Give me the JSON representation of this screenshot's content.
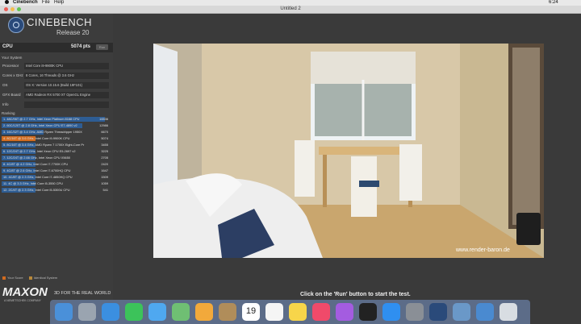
{
  "menubar": {
    "app": "Cinebench",
    "menus": [
      "File",
      "Help"
    ],
    "clock": "6:24"
  },
  "window": {
    "title": "Untitled 2"
  },
  "logo": {
    "title": "CINEBENCH",
    "release": "Release 20"
  },
  "cpu": {
    "label": "CPU",
    "score": "5074 pts",
    "run_label": "Run"
  },
  "system": {
    "heading": "Your System",
    "rows": [
      {
        "key": "Processor",
        "value": "Intel Core i9-9900K CPU"
      },
      {
        "key": "Cores x GHz",
        "value": "8 Cores, 16 Threads @ 3.6 GHz"
      },
      {
        "key": "OS",
        "value": "OS X: Version 10.15.6 (Build 19F101)"
      },
      {
        "key": "GFX Board",
        "value": "AMD Radeon RX 5700 XT OpenGL Engine"
      },
      {
        "key": "Info",
        "value": ""
      }
    ]
  },
  "ranking": {
    "heading": "Ranking",
    "rows": [
      {
        "name": "1. 48C/96T @ 2.7 GHz, Intel Xeon Platinum 8168 CPU",
        "score": "16536",
        "fill": 1.0,
        "mine": false
      },
      {
        "name": "2. 60C/120T @ 2.8 GHz, Intel Xeon CPU E7-4890 v2",
        "score": "12986",
        "fill": 0.785,
        "mine": false
      },
      {
        "name": "3. 16C/32T @ 3.4 GHz, AMD Ryzen Threadripper 1950X",
        "score": "6670",
        "fill": 0.403,
        "mine": false
      },
      {
        "name": "4. 8C/16T @ 3.6 GHz, Intel Core i9-9900K CPU",
        "score": "5074",
        "fill": 0.307,
        "mine": true
      },
      {
        "name": "5. 8C/16T @ 3.4 GHz, AMD Ryzen 7 1700X Eight-Core Pr",
        "score": "3455",
        "fill": 0.209,
        "mine": false
      },
      {
        "name": "6. 12C/24T @ 2.7 GHz, Intel Xeon CPU E5-2697 v2",
        "score": "3225",
        "fill": 0.195,
        "mine": false
      },
      {
        "name": "7. 12C/24T @ 2.66 GHz, Intel Xeon CPU X5650",
        "score": "2705",
        "fill": 0.164,
        "mine": false
      },
      {
        "name": "8. 4C/8T @ 4.2 GHz, Intel Core i7-7700K CPU",
        "score": "2420",
        "fill": 0.146,
        "mine": false
      },
      {
        "name": "9. 4C/8T @ 2.6 GHz, Intel Core i7-6700HQ CPU",
        "score": "1647",
        "fill": 0.1,
        "mine": false
      },
      {
        "name": "10. 4C/8T @ 2.3 GHz, Intel Core i7-4850HQ CPU",
        "score": "1509",
        "fill": 0.091,
        "mine": false
      },
      {
        "name": "11. 4C @ 3.3 GHz, Intel Core i5-3550 CPU",
        "score": "1059",
        "fill": 0.064,
        "mine": false
      },
      {
        "name": "12. 2C/4T @ 2.3 GHz, Intel Core i5-5300U CPU",
        "score": "541",
        "fill": 0.033,
        "mine": false
      }
    ]
  },
  "legend": {
    "your_score": "Your Score",
    "identical": "Identical System"
  },
  "brand": {
    "name": "MAXON",
    "sub": "A NEMETSCHEK COMPANY",
    "tagline": "3D FOR THE REAL WORLD"
  },
  "render": {
    "watermark": "www.render-baron.de"
  },
  "status": {
    "text": "Click on the 'Run' button to start the test."
  },
  "dock": {
    "icons": [
      {
        "name": "finder-icon",
        "color": "#4a90d9"
      },
      {
        "name": "launchpad-icon",
        "color": "#9aa4b0"
      },
      {
        "name": "safari-icon",
        "color": "#3b8fe0"
      },
      {
        "name": "facetime-icon",
        "color": "#3cc35a"
      },
      {
        "name": "messages-icon",
        "color": "#4fa8f0"
      },
      {
        "name": "maps-icon",
        "color": "#6fbf73"
      },
      {
        "name": "photos-icon",
        "color": "#f2a93b"
      },
      {
        "name": "contacts-icon",
        "color": "#b08d5a"
      },
      {
        "name": "calendar-icon",
        "color": "#ffffff"
      },
      {
        "name": "reminders-icon",
        "color": "#f5f5f5"
      },
      {
        "name": "notes-icon",
        "color": "#f7d54a"
      },
      {
        "name": "music-icon",
        "color": "#f04a6a"
      },
      {
        "name": "podcasts-icon",
        "color": "#a45ce0"
      },
      {
        "name": "tv-icon",
        "color": "#222222"
      },
      {
        "name": "app-store-icon",
        "color": "#2f8ff0"
      },
      {
        "name": "system-preferences-icon",
        "color": "#8a8f96"
      },
      {
        "name": "cinebench-icon",
        "color": "#2a4a7a"
      },
      {
        "name": "preview-icon",
        "color": "#6a98c8"
      },
      {
        "name": "downloads-icon",
        "color": "#4a8ad0"
      },
      {
        "name": "trash-icon",
        "color": "#d8dde2"
      }
    ],
    "calendar_day": "19"
  }
}
